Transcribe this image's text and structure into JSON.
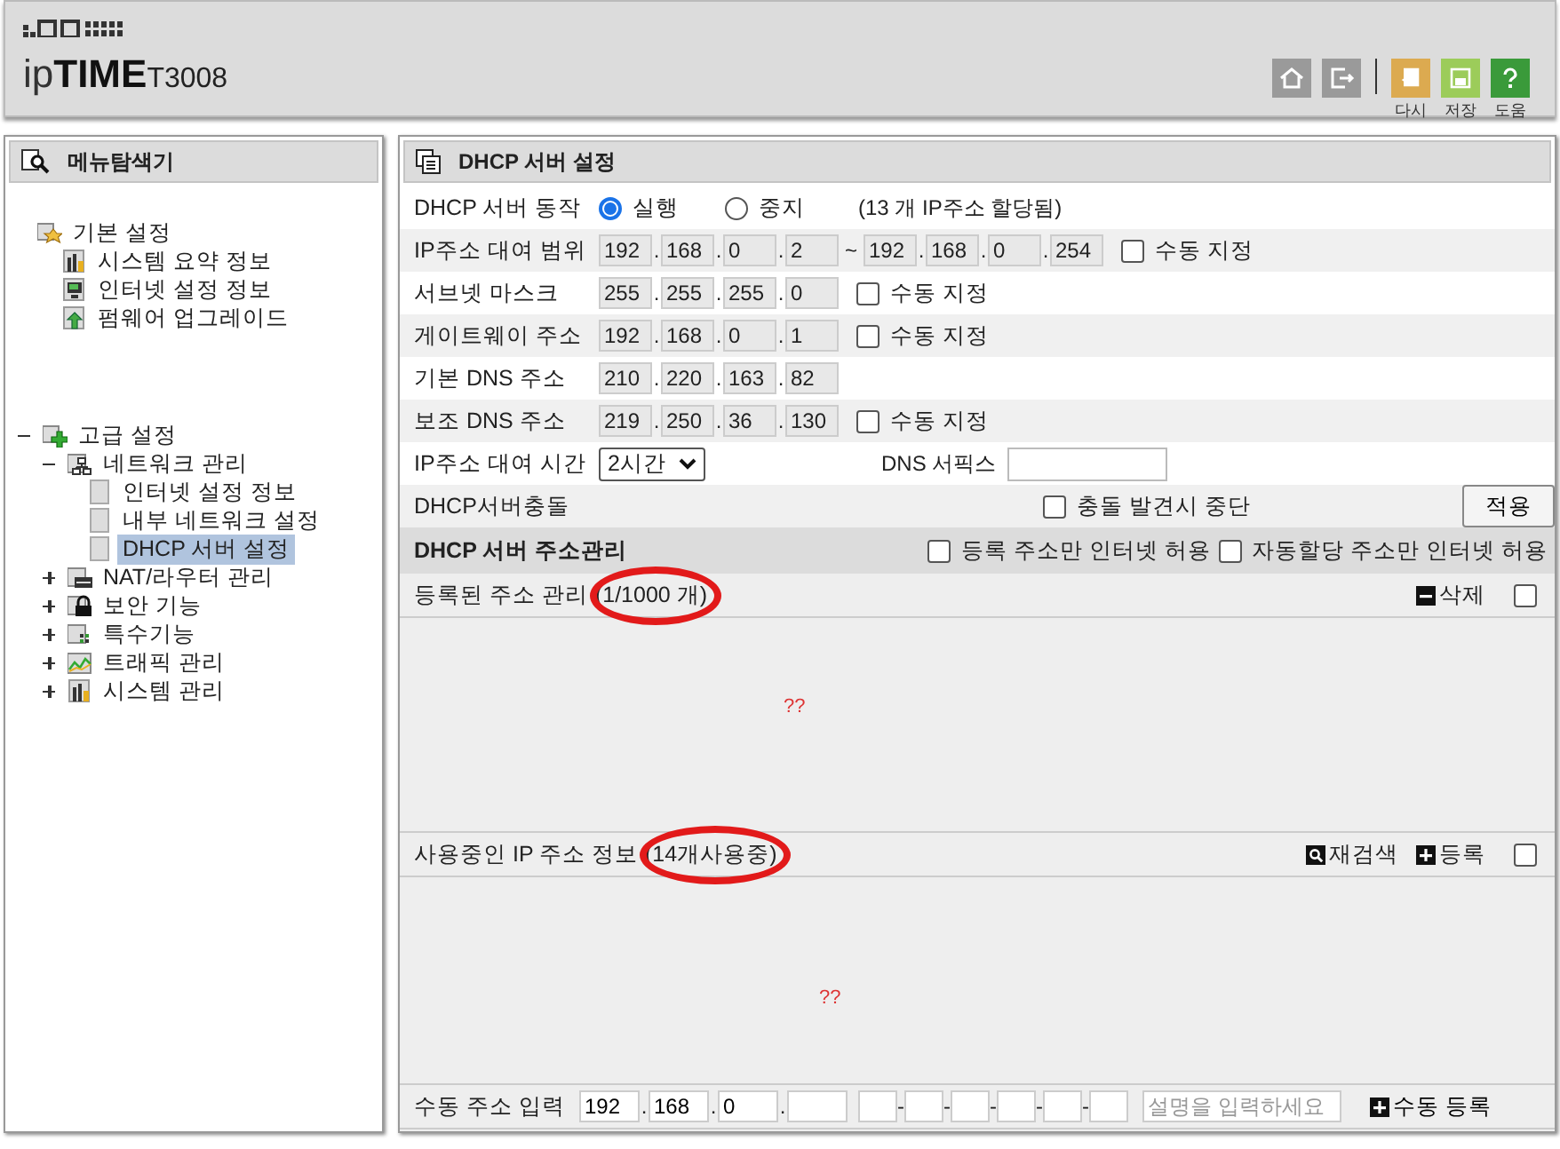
{
  "header": {
    "brand": "ip**TIME**",
    "model": "T3008",
    "toolbar": [
      {
        "kind": "home"
      },
      {
        "kind": "logout"
      },
      {
        "kind": "undo",
        "label": "다시"
      },
      {
        "kind": "save",
        "label": "저장"
      },
      {
        "kind": "help",
        "label": "도움"
      }
    ]
  },
  "sidebar": {
    "title": "메뉴탐색기",
    "tree": [
      {
        "label": "기본 설정",
        "kind": "folder-star",
        "selected": false,
        "children": [
          {
            "label": "시스템 요약 정보",
            "kind": "chart",
            "selected": false
          },
          {
            "label": "인터넷 설정 정보",
            "kind": "monitor",
            "selected": false
          },
          {
            "label": "펌웨어 업그레이드",
            "kind": "upload",
            "selected": false
          }
        ]
      },
      {
        "label": "고급 설정",
        "kind": "folder-plus",
        "expanded": true,
        "selected": false,
        "children": [
          {
            "label": "네트워크 관리",
            "kind": "network",
            "expanded": true,
            "selected": false,
            "children": [
              {
                "label": "인터넷 설정 정보",
                "kind": "page",
                "selected": false
              },
              {
                "label": "내부 네트워크 설정",
                "kind": "page",
                "selected": false
              },
              {
                "label": "DHCP 서버 설정",
                "kind": "page",
                "selected": true
              }
            ]
          },
          {
            "label": "NAT/라우터 관리",
            "kind": "router",
            "expanded": false,
            "selected": false
          },
          {
            "label": "보안 기능",
            "kind": "lock",
            "expanded": false,
            "selected": false
          },
          {
            "label": "특수기능",
            "kind": "grid",
            "expanded": false,
            "selected": false
          },
          {
            "label": "트래픽 관리",
            "kind": "graph",
            "expanded": false,
            "selected": false
          },
          {
            "label": "시스템 관리",
            "kind": "chart",
            "expanded": false,
            "selected": false
          }
        ]
      }
    ]
  },
  "form": {
    "title": "DHCP 서버 설정",
    "ip_separator": ".",
    "range_separator": "~",
    "rows": [
      {
        "kind": "radio",
        "label": "DHCP 서버 동작",
        "options": [
          {
            "label": "실행",
            "selected": true
          },
          {
            "label": "중지",
            "selected": false
          }
        ],
        "note": "(13 개 IP주소 할당됨)"
      },
      {
        "kind": "ip",
        "label": "IP주소 대여 범위",
        "ip": [
          "192",
          "168",
          "0",
          "2"
        ],
        "ip_to": [
          "192",
          "168",
          "0",
          "254"
        ],
        "checkbox": {
          "label": "수동 지정",
          "checked": false
        }
      },
      {
        "kind": "ip",
        "label": "서브넷 마스크",
        "ip": [
          "255",
          "255",
          "255",
          "0"
        ],
        "checkbox": {
          "label": "수동 지정",
          "checked": false
        }
      },
      {
        "kind": "ip",
        "label": "게이트웨이 주소",
        "ip": [
          "192",
          "168",
          "0",
          "1"
        ],
        "checkbox": {
          "label": "수동 지정",
          "checked": false
        }
      },
      {
        "kind": "ip",
        "label": "기본 DNS 주소",
        "ip": [
          "210",
          "220",
          "163",
          "82"
        ]
      },
      {
        "kind": "ip",
        "label": "보조 DNS 주소",
        "ip": [
          "219",
          "250",
          "36",
          "130"
        ],
        "checkbox": {
          "label": "수동 지정",
          "checked": false
        }
      },
      {
        "kind": "lease",
        "label": "IP주소 대여 시간",
        "select": "2시간",
        "suffix_label": "DNS 서픽스"
      },
      {
        "kind": "conflict",
        "label": "DHCP서버충돌",
        "checkbox": {
          "label": "충돌 발견시 중단",
          "checked": false
        },
        "button": "적용"
      }
    ]
  },
  "address_management": {
    "title": "DHCP 서버 주소관리",
    "options": [
      {
        "label": "등록 주소만 인터넷 허용",
        "checked": false
      },
      {
        "label": "자동할당 주소만 인터넷 허용",
        "checked": false
      }
    ],
    "sections": [
      {
        "label": "등록된 주소 관리",
        "count": "(1/1000 개)",
        "circled": true,
        "actions": [
          {
            "kind": "delete",
            "label": "삭제"
          }
        ],
        "checked": false,
        "body": "??"
      },
      {
        "label": "사용중인 IP 주소 정보",
        "count": "(14개사용중)",
        "circled": true,
        "actions": [
          {
            "kind": "search",
            "label": "재검색"
          },
          {
            "kind": "add",
            "label": "등록"
          }
        ],
        "checked": false,
        "body": "??"
      }
    ],
    "manual": {
      "label": "수동 주소 입력",
      "ip": [
        "192",
        "168",
        "0"
      ],
      "mac_separator": "-",
      "placeholder": "설명을 입력하세요",
      "button": "수동 등록"
    }
  }
}
